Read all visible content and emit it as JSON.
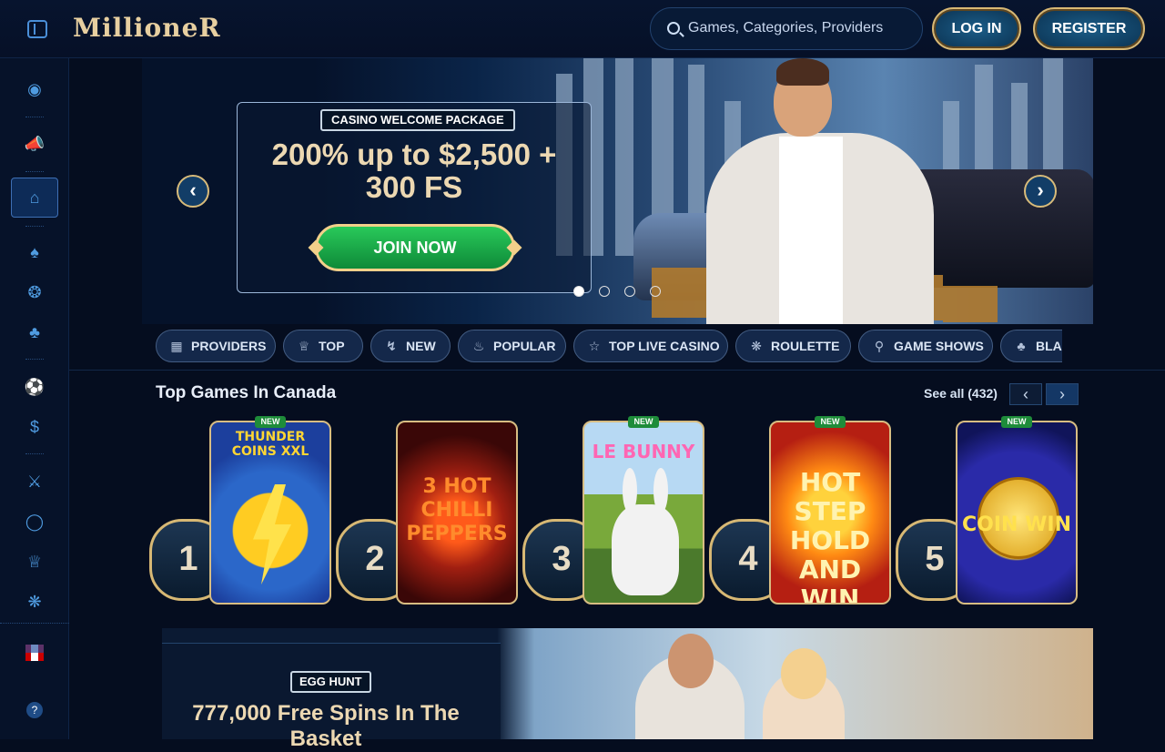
{
  "header": {
    "logo": "MillioneR",
    "search_placeholder": "Games, Categories, Providers",
    "login_label": "LOG IN",
    "register_label": "REGISTER"
  },
  "sidebar": {
    "items": [
      {
        "icon": "egg-icon"
      },
      {
        "icon": "megaphone-icon"
      },
      {
        "icon": "home-icon",
        "active": true
      },
      {
        "icon": "spade-icon"
      },
      {
        "icon": "chip-icon"
      },
      {
        "icon": "clover-icon"
      },
      {
        "icon": "soccer-ball-icon"
      },
      {
        "icon": "dollar-coin-icon"
      },
      {
        "icon": "crossed-swords-icon"
      },
      {
        "icon": "medal-icon"
      },
      {
        "icon": "crown-icon"
      },
      {
        "icon": "roulette-icon"
      }
    ],
    "language_icon": "uk-flag-icon",
    "help_icon": "help-icon"
  },
  "hero": {
    "badge": "CASINO WELCOME PACKAGE",
    "title": "200% up to $2,500 + 300 FS",
    "cta": "JOIN NOW",
    "slides_total": 4,
    "active_slide": 1
  },
  "categories": [
    {
      "label": "PROVIDERS",
      "icon": "book-icon"
    },
    {
      "label": "TOP",
      "icon": "crown-icon"
    },
    {
      "label": "NEW",
      "icon": "lightning-icon"
    },
    {
      "label": "POPULAR",
      "icon": "fire-icon"
    },
    {
      "label": "TOP LIVE CASINO",
      "icon": "star-icon"
    },
    {
      "label": "ROULETTE",
      "icon": "roulette-icon"
    },
    {
      "label": "GAME SHOWS",
      "icon": "microphone-icon"
    },
    {
      "label": "BLA",
      "icon": "cards-icon"
    }
  ],
  "top_games": {
    "title": "Top Games In Canada",
    "see_all": "See all (432)",
    "games": [
      {
        "rank": "1",
        "name": "THUNDER COINS XXL",
        "badge": "NEW"
      },
      {
        "rank": "2",
        "name": "3 HOT CHILLI PEPPERS",
        "badge": ""
      },
      {
        "rank": "3",
        "name": "LE BUNNY",
        "badge": "NEW"
      },
      {
        "rank": "4",
        "name": "HOT STEP HOLD AND WIN",
        "badge": "NEW"
      },
      {
        "rank": "5",
        "name": "COIN WIN",
        "badge": "NEW"
      }
    ]
  },
  "bottom_banner": {
    "badge": "EGG HUNT",
    "title": "777,000 Free Spins In The Basket"
  },
  "colors": {
    "background": "#050d1f",
    "gold": "#d8bd82",
    "accent_blue": "#4f9be0",
    "cta_green": "#1ea84c"
  }
}
